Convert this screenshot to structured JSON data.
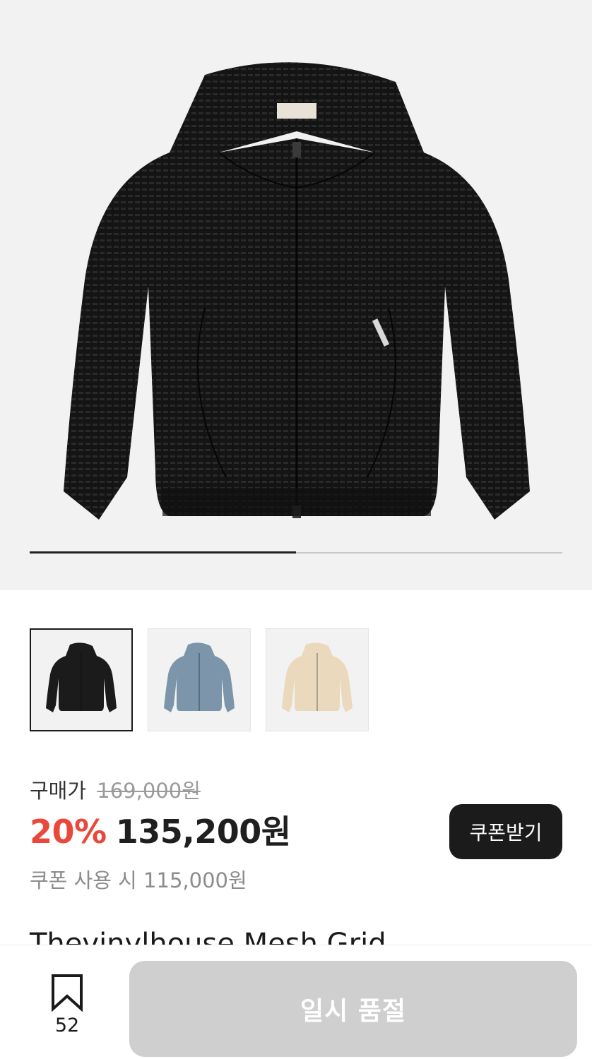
{
  "gallery": {
    "progress": 0.5,
    "thumbnails": [
      {
        "label": "black",
        "color": "#1b1b1b",
        "selected": true
      },
      {
        "label": "blue",
        "color": "#7d95aa",
        "selected": false
      },
      {
        "label": "cream",
        "color": "#ead9bd",
        "selected": false
      }
    ]
  },
  "price": {
    "label": "구매가",
    "original": "169,000원",
    "discount": "20%",
    "sale": "135,200원",
    "coupon_note": "쿠폰 사용 시 115,000원",
    "coupon_button": "쿠폰받기"
  },
  "product": {
    "name": "Thevinylhouse Mesh Grid"
  },
  "bottom_bar": {
    "bookmark_count": "52",
    "soldout_label": "일시 품절"
  },
  "colors": {
    "accent_red": "#e9483b",
    "dark": "#1b1b1b",
    "disabled": "#cfcfcf"
  }
}
